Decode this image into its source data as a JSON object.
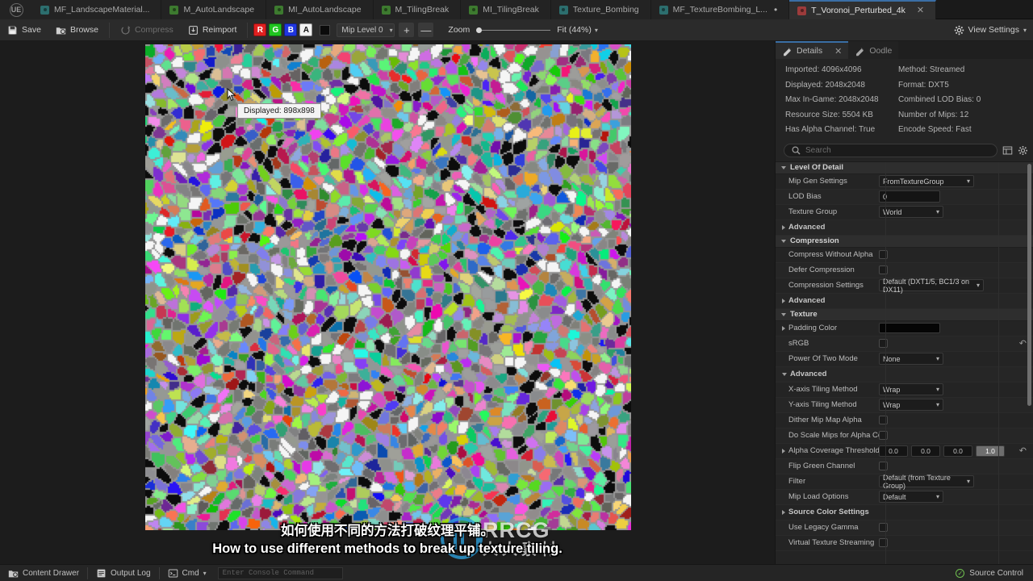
{
  "app": {
    "logo_icon": "unreal-engine-logo"
  },
  "tabs": [
    {
      "label": "MF_LandscapeMaterial...",
      "icon": "material-function-icon",
      "color": "#2c6e6e",
      "active": false,
      "dirty": false
    },
    {
      "label": "M_AutoLandscape",
      "icon": "material-icon",
      "color": "#3d7a2f",
      "active": false,
      "dirty": false
    },
    {
      "label": "MI_AutoLandscape",
      "icon": "material-instance-icon",
      "color": "#3d7a2f",
      "active": false,
      "dirty": false
    },
    {
      "label": "M_TilingBreak",
      "icon": "material-icon",
      "color": "#3d7a2f",
      "active": false,
      "dirty": false
    },
    {
      "label": "MI_TilingBreak",
      "icon": "material-instance-icon",
      "color": "#3d7a2f",
      "active": false,
      "dirty": false
    },
    {
      "label": "Texture_Bombing",
      "icon": "material-function-icon",
      "color": "#2c6e6e",
      "active": false,
      "dirty": false
    },
    {
      "label": "MF_TextureBombing_L...",
      "icon": "material-function-icon",
      "color": "#2c6e6e",
      "active": false,
      "dirty": true
    },
    {
      "label": "T_Voronoi_Perturbed_4k",
      "icon": "texture-icon",
      "color": "#9c3b3b",
      "active": true,
      "dirty": false
    }
  ],
  "toolbar": {
    "save_label": "Save",
    "browse_label": "Browse",
    "compress_label": "Compress",
    "reimport_label": "Reimport",
    "channels": [
      {
        "label": "R",
        "color": "#e02020"
      },
      {
        "label": "G",
        "color": "#1fc41f"
      },
      {
        "label": "B",
        "color": "#2036e0"
      },
      {
        "label": "A",
        "color": "#f2f2f2"
      }
    ],
    "mip_level": "Mip Level 0",
    "plus_label": "+",
    "minus_label": "—",
    "zoom_label": "Zoom",
    "zoom_fit": "Fit (44%)",
    "view_settings": "View Settings"
  },
  "viewport": {
    "tooltip": "Displayed: 898x898",
    "cursor_icon": "mouse-pointer-icon"
  },
  "subtitles": {
    "chinese": "如何使用不同的方法打破纹理平铺。",
    "english": "How to use different methods to break up texture tiling."
  },
  "watermark": {
    "line1": "RRCG",
    "line2": "人人素材",
    "accent": "#2ea3e0"
  },
  "details": {
    "tab_details": "Details",
    "tab_oodle": "Oodle",
    "info": [
      {
        "label": "Imported: 4096x4096"
      },
      {
        "label": "Method: Streamed"
      },
      {
        "label": "Displayed: 2048x2048"
      },
      {
        "label": "Format: DXT5"
      },
      {
        "label": "Max In-Game: 2048x2048"
      },
      {
        "label": "Combined LOD Bias: 0"
      },
      {
        "label": "Resource Size: 5504 KB"
      },
      {
        "label": "Number of Mips: 12"
      },
      {
        "label": "Has Alpha Channel: True"
      },
      {
        "label": "Encode Speed: Fast"
      }
    ],
    "search_placeholder": "Search",
    "sections": [
      {
        "title": "Level Of Detail",
        "rows": [
          {
            "label": "Mip Gen Settings",
            "type": "dropdown",
            "value": "FromTextureGroup",
            "width": "w118"
          },
          {
            "label": "LOD Bias",
            "type": "text",
            "value": "0"
          },
          {
            "label": "Texture Group",
            "type": "dropdown",
            "value": "World",
            "width": "w80"
          },
          {
            "label": "Advanced",
            "type": "expander"
          }
        ]
      },
      {
        "title": "Compression",
        "rows": [
          {
            "label": "Compress Without Alpha",
            "type": "checkbox",
            "value": false
          },
          {
            "label": "Defer Compression",
            "type": "checkbox",
            "value": false
          },
          {
            "label": "Compression Settings",
            "type": "dropdown",
            "value": "Default (DXT1/5, BC1/3 on DX11)",
            "width": "w130"
          },
          {
            "label": "Advanced",
            "type": "expander"
          }
        ]
      },
      {
        "title": "Texture",
        "rows": [
          {
            "label": "Padding Color",
            "type": "color",
            "value": "#050505",
            "expandable": true
          },
          {
            "label": "sRGB",
            "type": "checkbox",
            "value": false,
            "revert": true
          },
          {
            "label": "Power Of Two Mode",
            "type": "dropdown",
            "value": "None",
            "width": "w80"
          },
          {
            "label": "Advanced",
            "type": "expander-open"
          },
          {
            "label": "X-axis Tiling Method",
            "type": "dropdown",
            "value": "Wrap",
            "width": "w80"
          },
          {
            "label": "Y-axis Tiling Method",
            "type": "dropdown",
            "value": "Wrap",
            "width": "w80"
          },
          {
            "label": "Dither Mip Map Alpha",
            "type": "checkbox",
            "value": false
          },
          {
            "label": "Do Scale Mips for Alpha Cove...",
            "type": "checkbox",
            "value": false
          },
          {
            "label": "Alpha Coverage Thresholds",
            "type": "vector4",
            "values": [
              "0.0",
              "0.0",
              "0.0",
              "1.0"
            ],
            "expandable": true,
            "revert": true
          },
          {
            "label": "Flip Green Channel",
            "type": "checkbox",
            "value": false
          },
          {
            "label": "Filter",
            "type": "dropdown",
            "value": "Default (from Texture Group)",
            "width": "w118"
          },
          {
            "label": "Mip Load Options",
            "type": "dropdown",
            "value": "Default",
            "width": "w80"
          },
          {
            "label": "Source Color Settings",
            "type": "expander"
          },
          {
            "label": "Use Legacy Gamma",
            "type": "checkbox",
            "value": false
          },
          {
            "label": "Virtual Texture Streaming",
            "type": "checkbox",
            "value": false
          }
        ]
      }
    ]
  },
  "statusbar": {
    "content_drawer": "Content Drawer",
    "output_log": "Output Log",
    "cmd": "Cmd",
    "console_placeholder": "Enter Console Command",
    "source_control": "Source Control"
  }
}
